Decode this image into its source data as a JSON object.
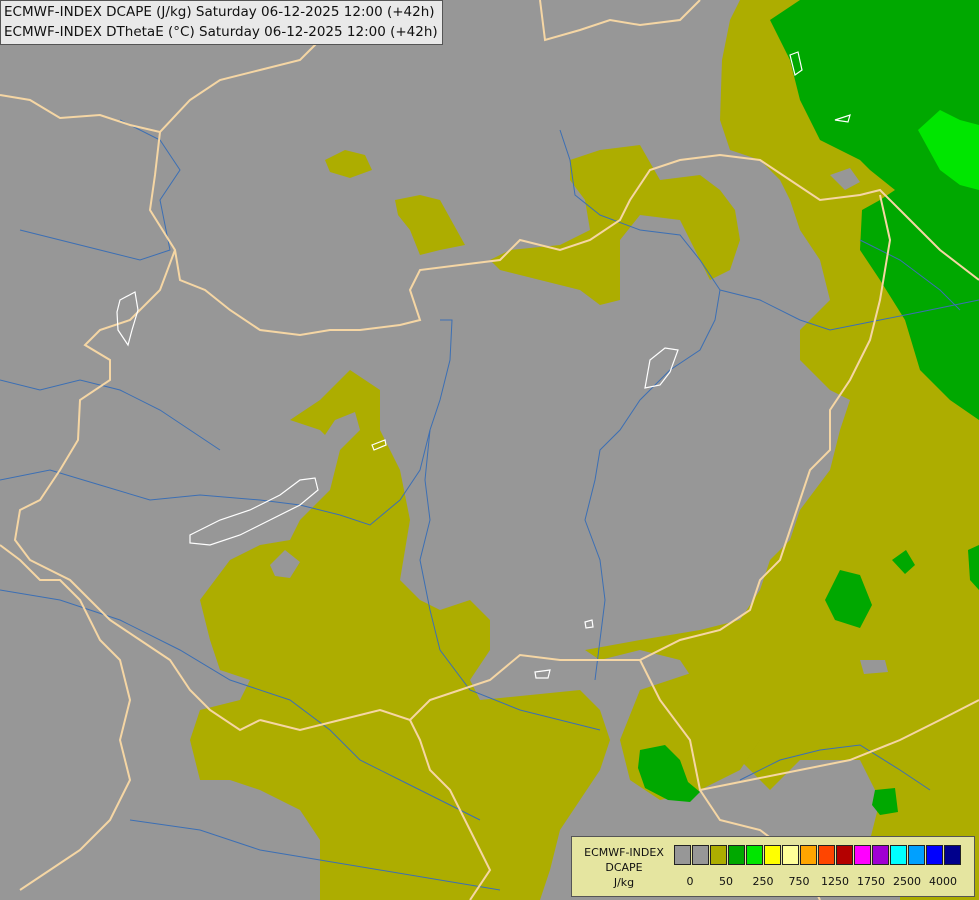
{
  "title": {
    "line1": "ECMWF-INDEX DCAPE (J/kg) Saturday 06-12-2025 12:00 (+42h)",
    "line2": "ECMWF-INDEX DThetaE (°C) Saturday 06-12-2025 12:00 (+42h)"
  },
  "map": {
    "background_color": "#979797",
    "border_color": "#f5d6a4",
    "river_color": "#3c6fb4",
    "lake_outline_color": "#ffffff"
  },
  "legend": {
    "name_line1": "ECMWF-INDEX",
    "name_line2": "DCAPE",
    "unit": "J/kg",
    "colors": [
      "#979797",
      "#979797",
      "#adad00",
      "#00a800",
      "#00e600",
      "#ffff00",
      "#ffff99",
      "#ffa500",
      "#ff4500",
      "#b40000",
      "#ff00ff",
      "#a000d2",
      "#00ffff",
      "#00a0ff",
      "#0000ff",
      "#00008c"
    ],
    "tick_labels": [
      "0",
      "50",
      "250",
      "750",
      "1250",
      "1750",
      "2500",
      "4000"
    ]
  }
}
